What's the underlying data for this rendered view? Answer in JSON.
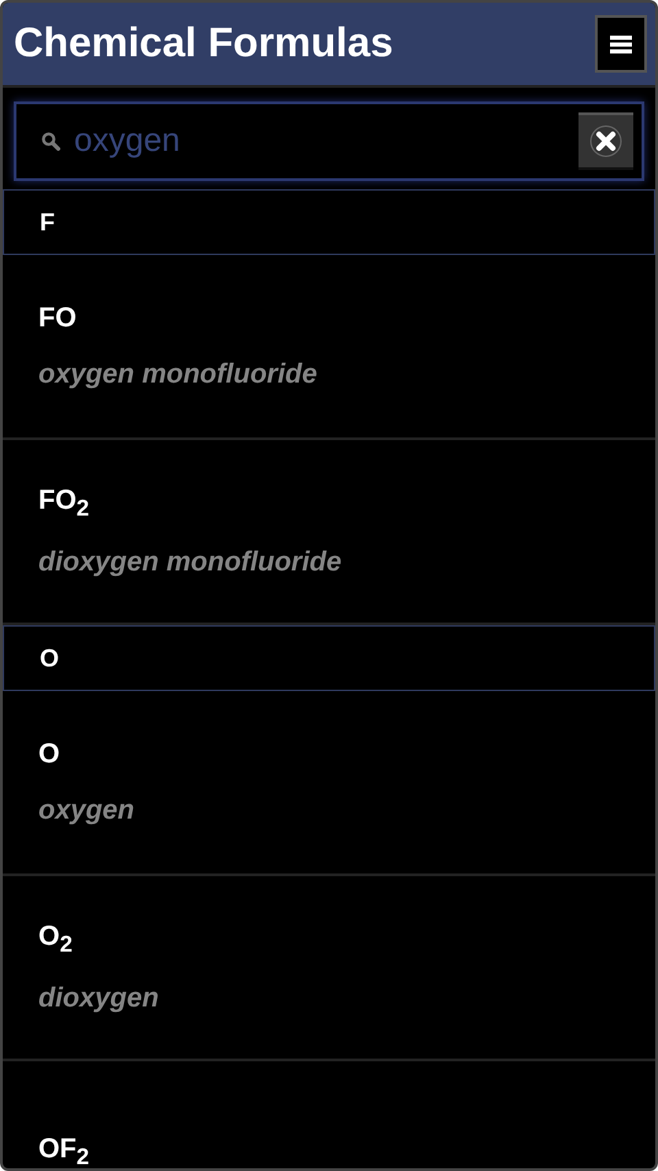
{
  "window": {
    "title": "Chemical Formulas"
  },
  "search": {
    "value": "oxygen"
  },
  "list": [
    {
      "kind": "header",
      "label": "F"
    },
    {
      "kind": "entry",
      "formula": "FO",
      "name": "oxygen monofluoride"
    },
    {
      "kind": "entry",
      "formula": "FO$_{2}$",
      "name": "dioxygen monofluoride"
    },
    {
      "kind": "header",
      "label": "O"
    },
    {
      "kind": "entry",
      "formula": "O",
      "name": "oxygen"
    },
    {
      "kind": "entry",
      "formula": "O$_{2}$",
      "name": "dioxygen"
    },
    {
      "kind": "entry",
      "formula": "OF$_{2}$"
    }
  ]
}
